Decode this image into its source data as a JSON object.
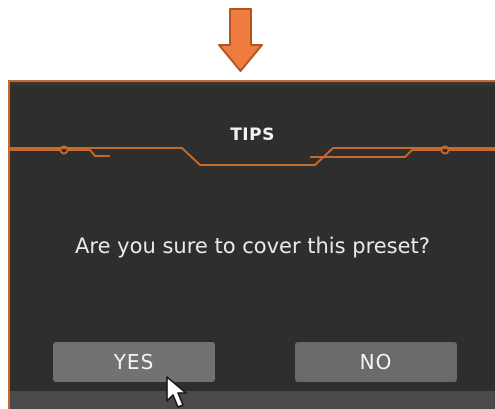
{
  "annotation": {
    "arrow_icon": "down-arrow-icon",
    "arrow_color": "#f07b3f",
    "arrow_border": "#b4531f"
  },
  "dialog": {
    "title": "TIPS",
    "message": "Are you sure to cover this preset?",
    "buttons": {
      "yes_label": "YES",
      "no_label": "NO"
    },
    "background_color": "#2e2e2e",
    "accent_color": "#c56a2c"
  },
  "pointer": {
    "icon": "mouse-pointer-icon"
  }
}
